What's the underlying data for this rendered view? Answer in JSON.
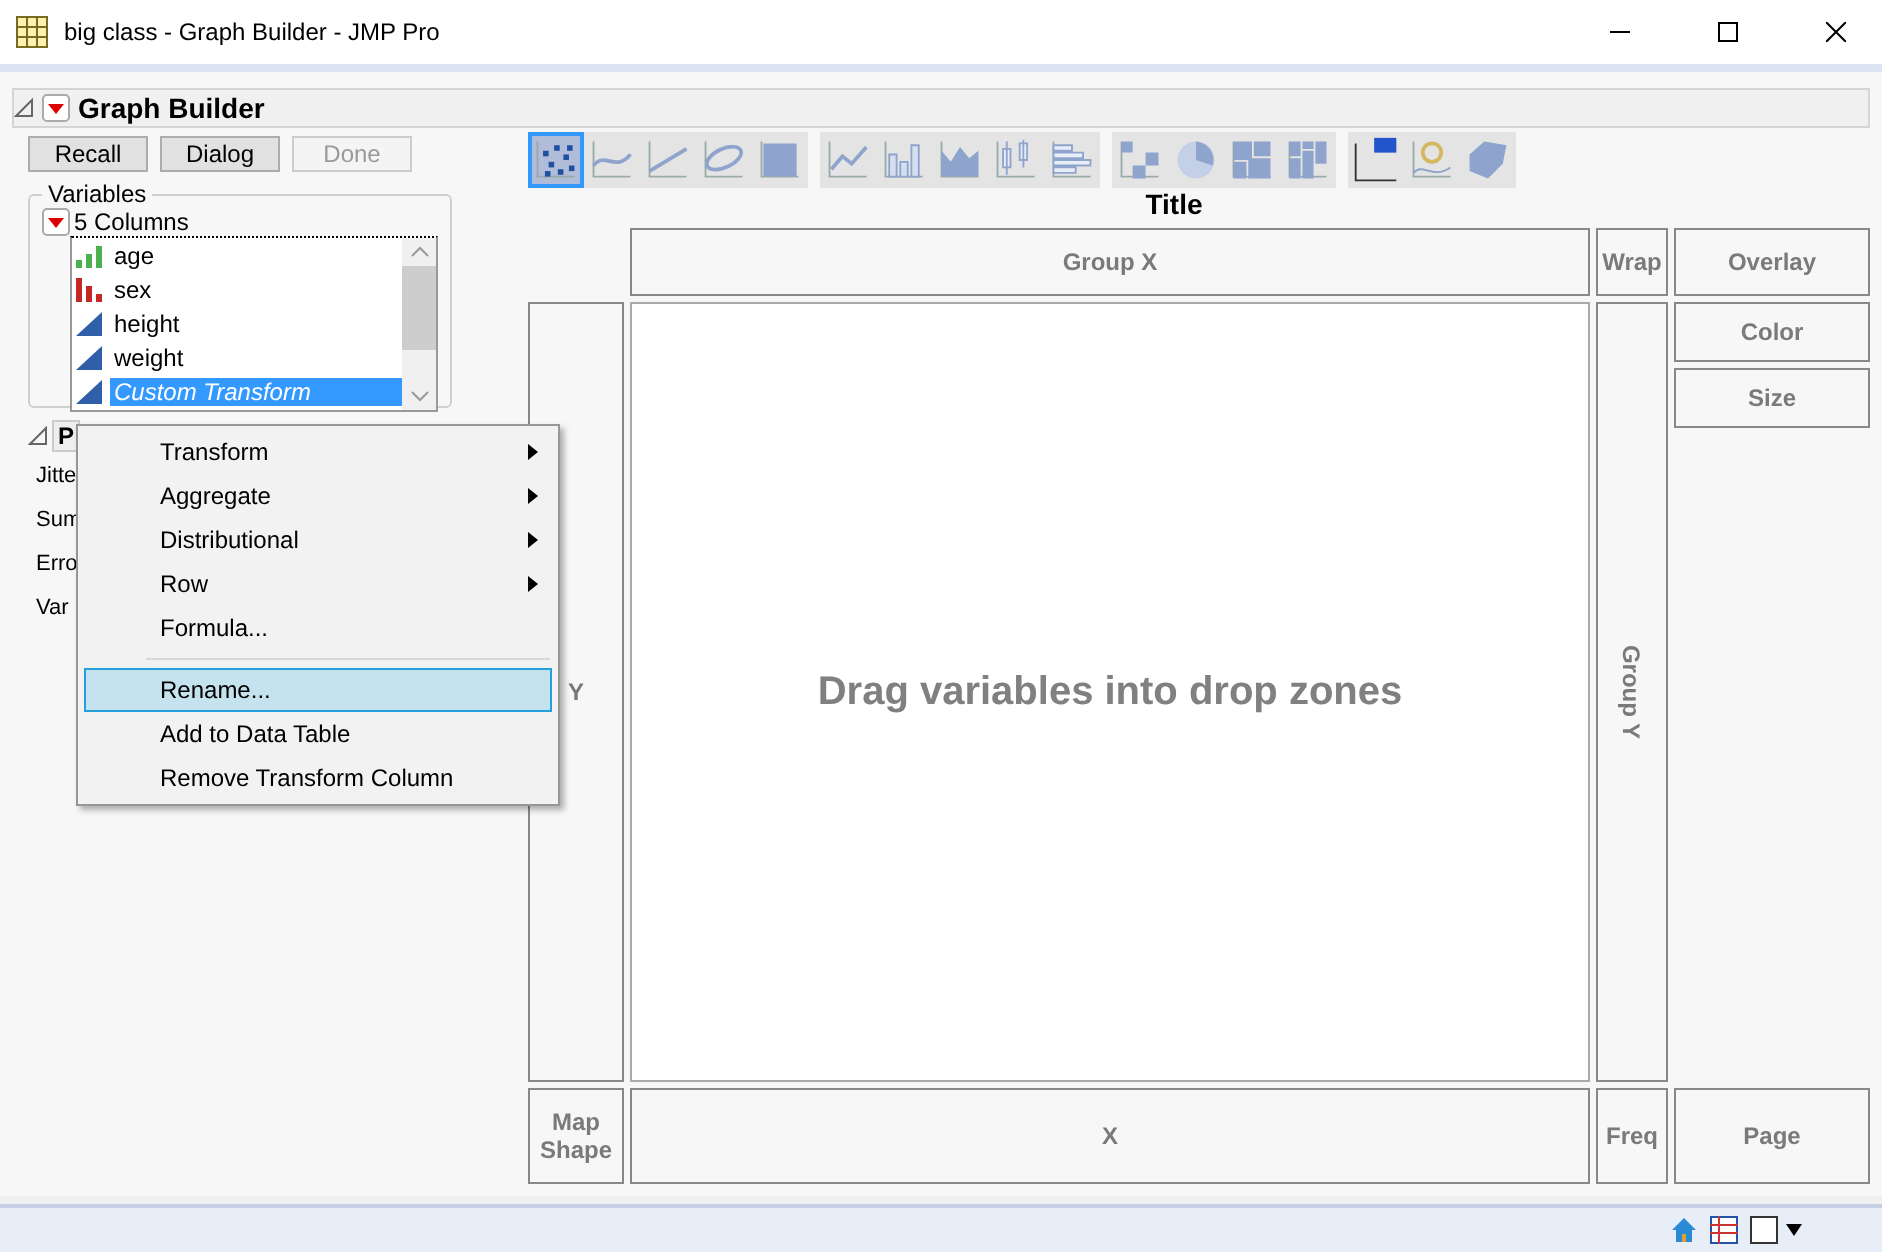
{
  "window": {
    "title": "big class - Graph Builder - JMP Pro"
  },
  "report": {
    "title": "Graph Builder",
    "expanded": true
  },
  "buttons": [
    {
      "label": "Recall",
      "disabled": false
    },
    {
      "label": "Dialog",
      "disabled": false
    },
    {
      "label": "Done",
      "disabled": true
    }
  ],
  "variables": {
    "legend": "Variables",
    "group": "5 Columns",
    "columns": [
      {
        "name": "age",
        "kind": "ordinal",
        "selected": false
      },
      {
        "name": "sex",
        "kind": "nominal",
        "selected": false
      },
      {
        "name": "height",
        "kind": "continuous",
        "selected": false
      },
      {
        "name": "weight",
        "kind": "continuous",
        "selected": false
      },
      {
        "name": "Custom Transform",
        "kind": "continuous",
        "selected": true
      }
    ]
  },
  "points_panel": {
    "title": "P",
    "rows": [
      "Jitte",
      "Sum",
      "Erro",
      "Var"
    ]
  },
  "context_menu": [
    {
      "label": "Transform",
      "submenu": true,
      "highlighted": false
    },
    {
      "label": "Aggregate",
      "submenu": true,
      "highlighted": false
    },
    {
      "label": "Distributional",
      "submenu": true,
      "highlighted": false
    },
    {
      "label": "Row",
      "submenu": true,
      "highlighted": false
    },
    {
      "label": "Formula...",
      "submenu": false,
      "highlighted": false
    },
    {
      "kind": "separator"
    },
    {
      "label": "Rename...",
      "submenu": false,
      "highlighted": true
    },
    {
      "label": "Add to Data Table",
      "submenu": false,
      "highlighted": false
    },
    {
      "label": "Remove Transform Column",
      "submenu": false,
      "highlighted": false
    }
  ],
  "toolbar": [
    [
      {
        "kind": "points",
        "selected": true
      },
      {
        "kind": "smoother",
        "selected": false
      },
      {
        "kind": "fit",
        "selected": false
      },
      {
        "kind": "ellipse",
        "selected": false
      },
      {
        "kind": "contour",
        "selected": false
      }
    ],
    [
      {
        "kind": "line",
        "selected": false
      },
      {
        "kind": "bar",
        "selected": false
      },
      {
        "kind": "area",
        "selected": false
      },
      {
        "kind": "box",
        "selected": false
      },
      {
        "kind": "histogram",
        "selected": false
      }
    ],
    [
      {
        "kind": "heatmap",
        "selected": false
      },
      {
        "kind": "pie",
        "selected": false
      },
      {
        "kind": "treemap",
        "selected": false
      },
      {
        "kind": "mosaic",
        "selected": false
      }
    ],
    [
      {
        "kind": "caption",
        "selected": false
      },
      {
        "kind": "formula",
        "selected": false
      },
      {
        "kind": "map",
        "selected": false
      }
    ]
  ],
  "graph": {
    "title": "Title",
    "group_x": "Group X",
    "wrap": "Wrap",
    "overlay": "Overlay",
    "color_zone": "Color",
    "size": "Size",
    "y": "Y",
    "hint": "Drag variables into drop zones",
    "group_y": "Group Y",
    "map_shape": [
      "Map",
      "Shape"
    ],
    "x": "X",
    "freq": "Freq",
    "page": "Page"
  }
}
